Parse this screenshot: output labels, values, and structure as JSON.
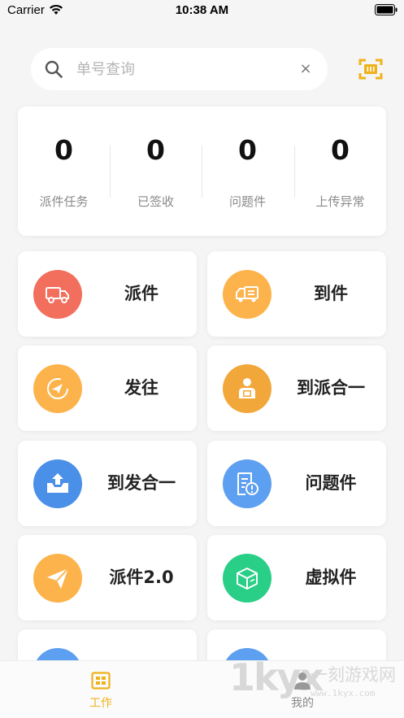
{
  "status_bar": {
    "carrier": "Carrier",
    "time": "10:38 AM"
  },
  "search": {
    "placeholder": "单号查询",
    "value": "",
    "clear_glyph": "×"
  },
  "stats": [
    {
      "value": "0",
      "label": "派件任务"
    },
    {
      "value": "0",
      "label": "已签收"
    },
    {
      "value": "0",
      "label": "问题件"
    },
    {
      "value": "0",
      "label": "上传异常"
    }
  ],
  "functions": [
    {
      "label": "派件",
      "icon": "delivery-truck-icon",
      "color": "#f26e5d"
    },
    {
      "label": "到件",
      "icon": "arrival-truck-icon",
      "color": "#fdb34b"
    },
    {
      "label": "发往",
      "icon": "send-compass-icon",
      "color": "#fdb34b"
    },
    {
      "label": "到派合一",
      "icon": "courier-package-icon",
      "color": "#f2a73a"
    },
    {
      "label": "到发合一",
      "icon": "upload-tray-icon",
      "color": "#4a90e8"
    },
    {
      "label": "问题件",
      "icon": "problem-document-icon",
      "color": "#5d9ff0"
    },
    {
      "label": "派件2.0",
      "icon": "paper-plane-icon",
      "color": "#fdb34b"
    },
    {
      "label": "虚拟件",
      "icon": "virtual-box-icon",
      "color": "#29cf86"
    },
    {
      "label": "",
      "icon": "blue-circle-icon",
      "color": "#5d9ff0"
    },
    {
      "label": "",
      "icon": "blue-circle-icon",
      "color": "#5d9ff0"
    }
  ],
  "tab_bar": {
    "tabs": [
      {
        "label": "工作",
        "icon": "work-grid-icon",
        "active": true
      },
      {
        "label": "我的",
        "icon": "person-icon",
        "active": false
      }
    ]
  },
  "watermark": {
    "logo": "1kyx",
    "name": "一刻游戏网",
    "url": "www.1kyx.com"
  },
  "colors": {
    "accent": "#f0b21b",
    "inactive": "#888888",
    "background": "#f5f5f5"
  }
}
